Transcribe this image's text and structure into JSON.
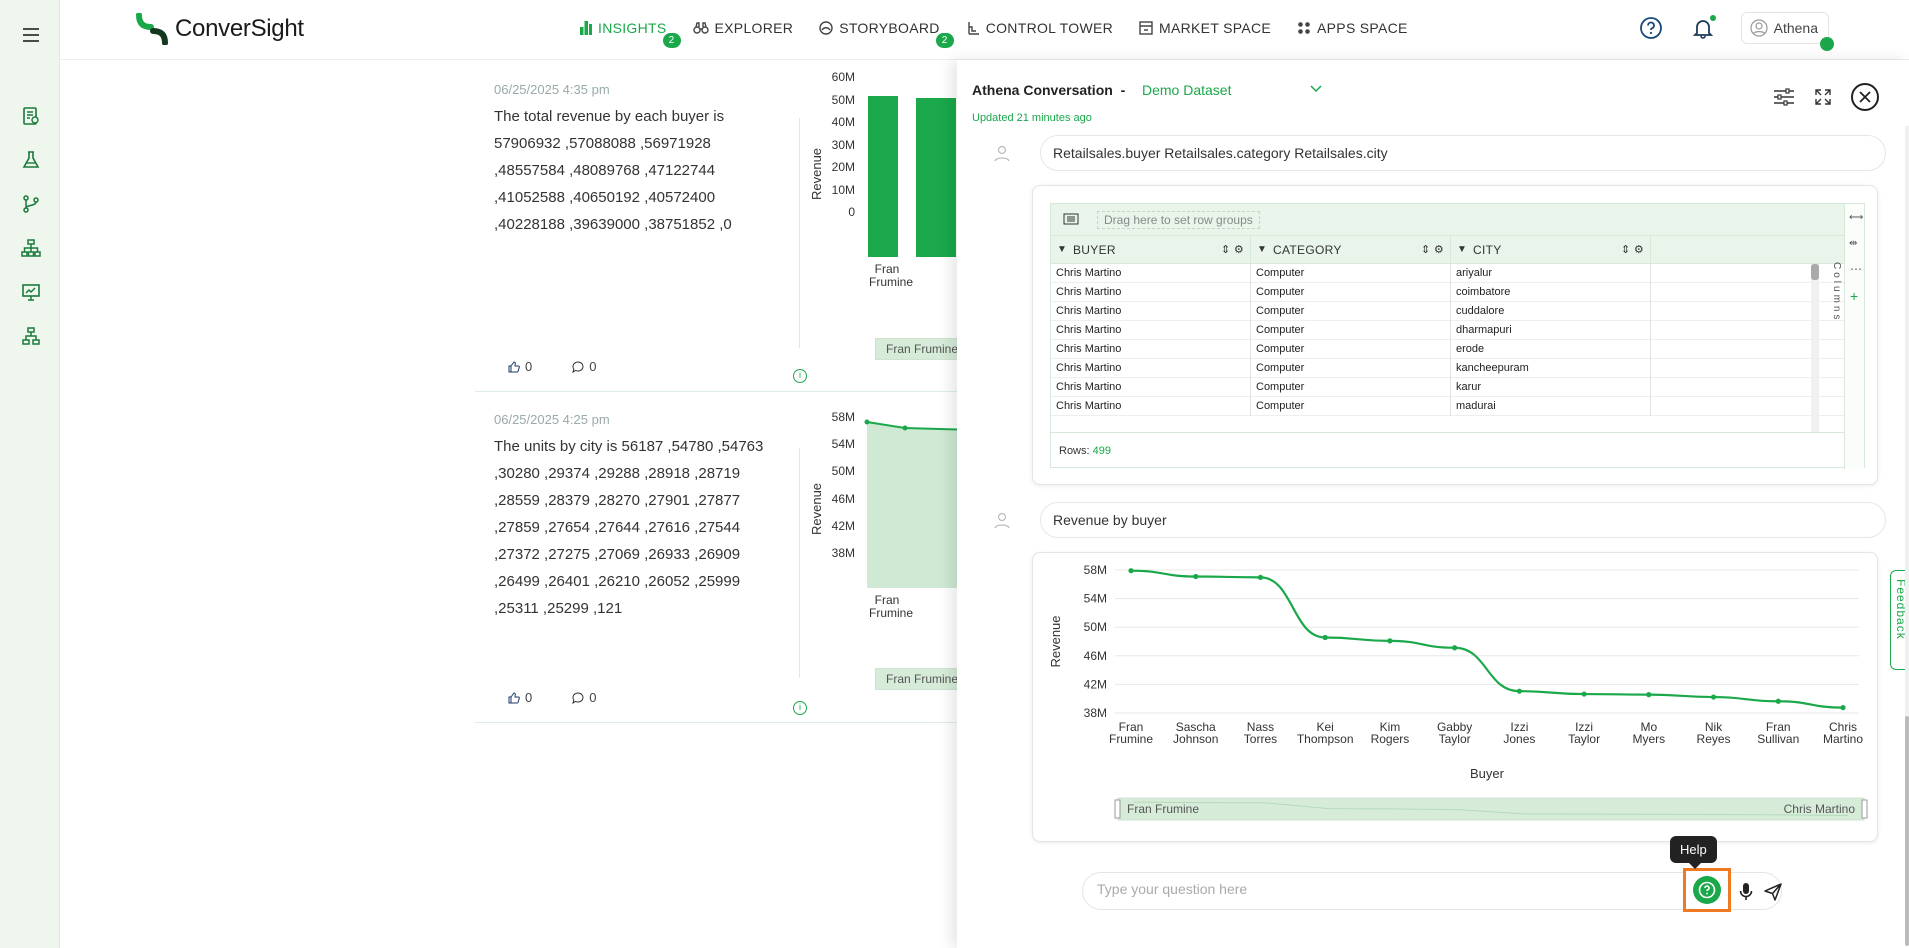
{
  "brand": {
    "name": "ConverSight"
  },
  "nav": [
    {
      "label": "INSIGHTS",
      "icon": "bar-chart-icon",
      "badge": "2",
      "active": true
    },
    {
      "label": "EXPLORER",
      "icon": "binoculars-icon",
      "badge": "",
      "active": false
    },
    {
      "label": "STORYBOARD",
      "icon": "storyboard-icon",
      "badge": "2",
      "active": false
    },
    {
      "label": "CONTROL TOWER",
      "icon": "control-tower-icon",
      "badge": "",
      "active": false
    },
    {
      "label": "MARKET SPACE",
      "icon": "market-icon",
      "badge": "",
      "active": false
    },
    {
      "label": "APPS SPACE",
      "icon": "apps-icon",
      "badge": "",
      "active": false
    }
  ],
  "user": {
    "name": "Athena"
  },
  "cards": [
    {
      "time": "06/25/2025 4:35 pm",
      "text": "The total revenue by each buyer is 57906932 ,57088088 ,56971928 ,48557584 ,48089768 ,47122744 ,41052588 ,40650192 ,40572400 ,40228188 ,39639000 ,38751852 ,0",
      "likes": "0",
      "comments": "0",
      "ylabel": "Revenue",
      "ticks": [
        "60M",
        "50M",
        "40M",
        "30M",
        "20M",
        "10M",
        "0"
      ],
      "xcat": "Fran Frumine",
      "scroll_label": "Fran Frumine",
      "chart_data": {
        "type": "bar",
        "categories": [
          "Fran Frumine"
        ],
        "values": [
          57906932
        ],
        "ylabel": "Revenue",
        "ylim": [
          0,
          60000000
        ]
      }
    },
    {
      "time": "06/25/2025 4:25 pm",
      "text": "The units by city is 56187 ,54780 ,54763 ,30280 ,29374 ,29288 ,28918 ,28719 ,28559 ,28379 ,28270 ,27901 ,27877 ,27859 ,27654 ,27644 ,27616 ,27544 ,27372 ,27275 ,27069 ,26933 ,26909 ,26499 ,26401 ,26210 ,26052 ,25999 ,25311 ,25299 ,121",
      "likes": "0",
      "comments": "0",
      "ylabel": "Revenue",
      "ticks": [
        "58M",
        "54M",
        "50M",
        "46M",
        "42M",
        "38M"
      ],
      "xcat": "Fran Frumine",
      "scroll_label": "Fran Frumine"
    }
  ],
  "panel": {
    "title": "Athena Conversation",
    "separator": "-",
    "dataset": "Demo Dataset",
    "updated": "Updated 21 minutes ago",
    "query1": "Retailsales.buyer Retailsales.category Retailsales.city",
    "query2": "Revenue by buyer",
    "grid": {
      "group_hint": "Drag here to set row groups",
      "columns": [
        "BUYER",
        "CATEGORY",
        "CITY"
      ],
      "rows": [
        [
          "Chris Martino",
          "Computer",
          "ariyalur"
        ],
        [
          "Chris Martino",
          "Computer",
          "coimbatore"
        ],
        [
          "Chris Martino",
          "Computer",
          "cuddalore"
        ],
        [
          "Chris Martino",
          "Computer",
          "dharmapuri"
        ],
        [
          "Chris Martino",
          "Computer",
          "erode"
        ],
        [
          "Chris Martino",
          "Computer",
          "kancheepuram"
        ],
        [
          "Chris Martino",
          "Computer",
          "karur"
        ],
        [
          "Chris Martino",
          "Computer",
          "madurai"
        ]
      ],
      "rows_label": "Rows:",
      "rows_count": "499",
      "columns_label": "Columns"
    },
    "ask_placeholder": "Type your question here",
    "help_tooltip": "Help"
  },
  "chart_data": {
    "type": "line",
    "categories": [
      "Fran Frumine",
      "Sascha Johnson",
      "Nass Torres",
      "Kei Thompson",
      "Kim Rogers",
      "Gabby Taylor",
      "Izzi Jones",
      "Izzi Taylor",
      "Mo Myers",
      "Nik Reyes",
      "Fran Sullivan",
      "Chris Martino"
    ],
    "values": [
      57906932,
      57088088,
      56971928,
      48557584,
      48089768,
      47122744,
      41052588,
      40650192,
      40572400,
      40228188,
      39639000,
      38751852
    ],
    "ylabel": "Revenue",
    "xlabel": "Buyer",
    "yticks": [
      "58M",
      "54M",
      "50M",
      "46M",
      "42M",
      "38M"
    ],
    "ylim": [
      38000000,
      58000000
    ],
    "color": "#1aa84a",
    "navigator_start": "Fran Frumine",
    "navigator_end": "Chris Martino"
  },
  "feedback": "Feedback"
}
